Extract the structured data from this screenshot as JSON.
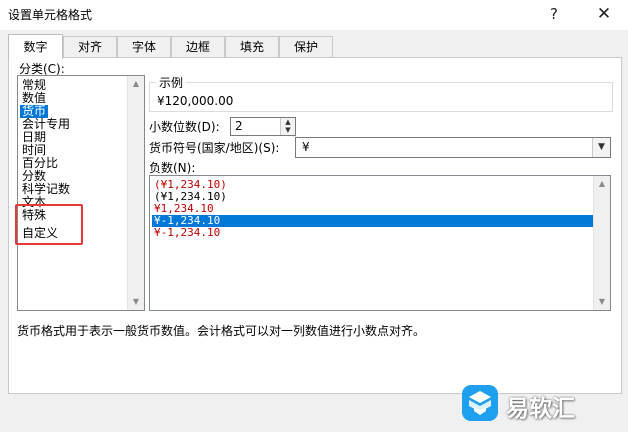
{
  "window": {
    "title": "设置单元格格式",
    "help_glyph": "?",
    "close_glyph": "✕"
  },
  "tabs": [
    {
      "label": "数字",
      "active": true
    },
    {
      "label": "对齐"
    },
    {
      "label": "字体"
    },
    {
      "label": "边框"
    },
    {
      "label": "填充"
    },
    {
      "label": "保护"
    }
  ],
  "category": {
    "label": "分类(C):",
    "items": [
      "常规",
      "数值",
      "货币",
      "会计专用",
      "日期",
      "时间",
      "百分比",
      "分数",
      "科学记数",
      "文本",
      "特殊",
      "自定义"
    ],
    "selected": "货币"
  },
  "sample": {
    "title": "示例",
    "value": "¥120,000.00"
  },
  "decimal": {
    "label": "小数位数(D):",
    "value": "2"
  },
  "symbol": {
    "label": "货币符号(国家/地区)(S):",
    "value": "¥"
  },
  "negative": {
    "label": "负数(N):",
    "items": [
      "(¥1,234.10)",
      "(¥1,234.10)",
      "¥1,234.10",
      "¥-1,234.10",
      "¥-1,234.10"
    ],
    "selected": "¥-1,234.10"
  },
  "description": "货币格式用于表示一般货币数值。会计格式可以对一列数值进行小数点对齐。",
  "watermark": {
    "text": "易软汇"
  },
  "colors": {
    "selection": "#0078d7",
    "negative_red": "#c00000",
    "highlight_box": "#e53935",
    "watermark_blue": "#1ea0ef"
  }
}
